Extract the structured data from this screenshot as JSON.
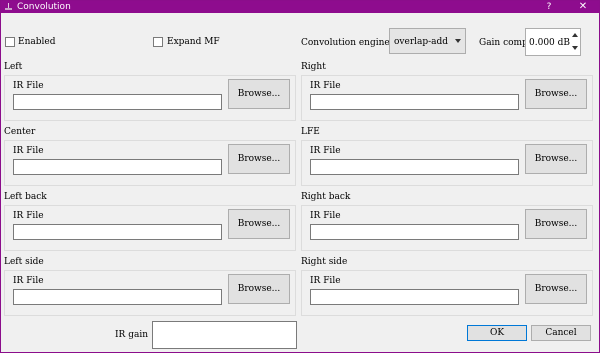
{
  "window": {
    "title": "Convolution",
    "help_label": "?",
    "close_label": "✕",
    "accent": "#8e0c8e"
  },
  "top": {
    "enabled_label": "Enabled",
    "expand_label": "Expand MF",
    "engine_label": "Convolution engine",
    "engine_value": "overlap-add",
    "gain_comp_label": "Gain comp",
    "gain_comp_value": "0.000 dB"
  },
  "channels": [
    {
      "title": "Left",
      "ir_label": "IR File",
      "browse_label": "Browse..."
    },
    {
      "title": "Right",
      "ir_label": "IR File",
      "browse_label": "Browse..."
    },
    {
      "title": "Center",
      "ir_label": "IR File",
      "browse_label": "Browse..."
    },
    {
      "title": "LFE",
      "ir_label": "IR File",
      "browse_label": "Browse..."
    },
    {
      "title": "Left back",
      "ir_label": "IR File",
      "browse_label": "Browse..."
    },
    {
      "title": "Right back",
      "ir_label": "IR File",
      "browse_label": "Browse..."
    },
    {
      "title": "Left side",
      "ir_label": "IR File",
      "browse_label": "Browse..."
    },
    {
      "title": "Right side",
      "ir_label": "IR File",
      "browse_label": "Browse..."
    }
  ],
  "footer": {
    "ir_gain_label": "IR gain",
    "ok_label": "OK",
    "cancel_label": "Cancel"
  }
}
